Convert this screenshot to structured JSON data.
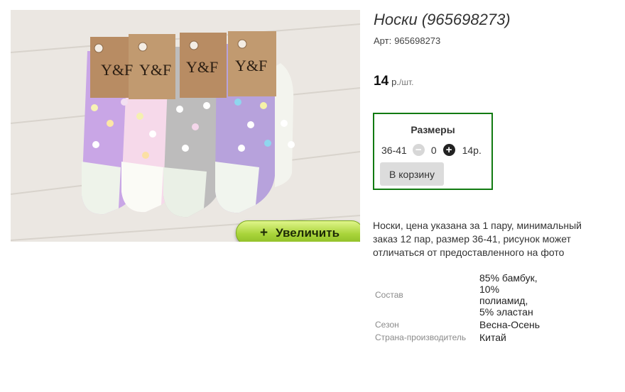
{
  "product": {
    "title": "Носки (965698273)",
    "sku_label": "Арт:",
    "sku_value": "965698273",
    "price": "14",
    "currency": "р.",
    "unit": "/шт.",
    "description": "Носки, цена указана за 1 пару, минимальный заказ 12 пар, размер 36-41, рисунок может отличаться от предоставленного на фото",
    "image_brand_text": "Y&F"
  },
  "gallery": {
    "zoom_label": "Увеличить",
    "zoom_icon": "+"
  },
  "sizes": {
    "title": "Размеры",
    "size": "36-41",
    "minus_symbol": "−",
    "quantity": "0",
    "plus_symbol": "+",
    "size_price": "14р.",
    "add_to_cart_label": "В корзину"
  },
  "attributes": [
    {
      "label": "Состав",
      "value": "85% бамбук, 10% полиамид, 5% эластан"
    },
    {
      "label": "Сезон",
      "value": "Весна-Осень"
    },
    {
      "label": "Страна-производитель",
      "value": "Китай"
    }
  ],
  "colors": {
    "frame_green": "#117a11",
    "zoom_button_green": "#a9d43a"
  }
}
